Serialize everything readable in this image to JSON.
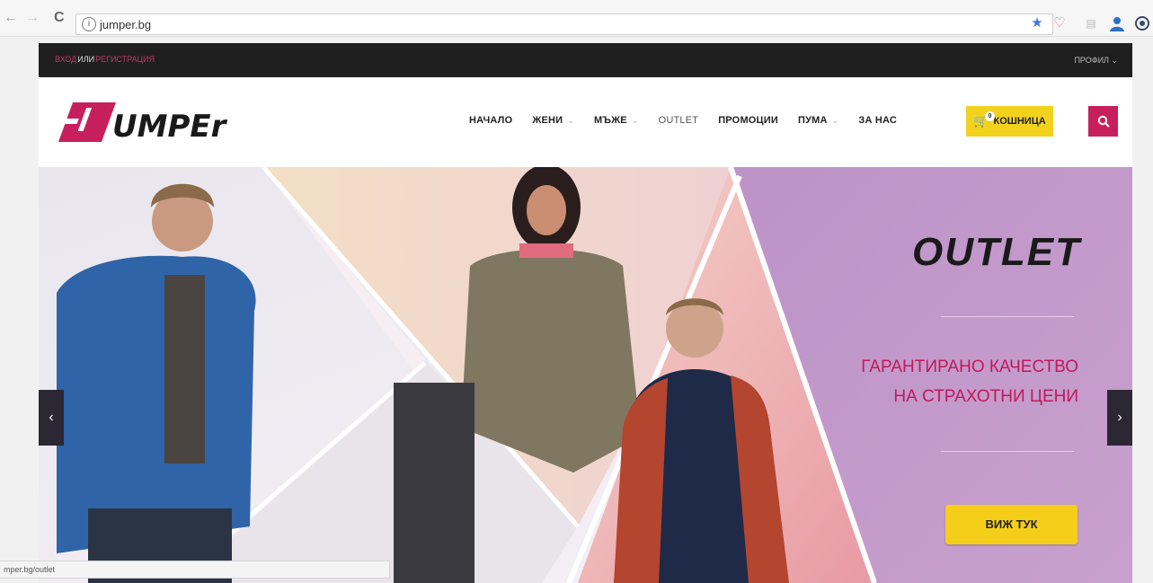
{
  "browser": {
    "back": "←",
    "forward": "→",
    "reload": "C",
    "url": "jumper.bg",
    "status_url": "mper.bg/outlet"
  },
  "site": {
    "topbar": {
      "login": "ВХОД",
      "or": "ИЛИ",
      "register": "РЕГИСТРАЦИЯ",
      "profile": "ПРОФИЛ ⌄"
    },
    "logo": {
      "text": "UMPEr"
    },
    "nav": [
      {
        "label": "НАЧАЛО"
      },
      {
        "label": "ЖЕНИ",
        "dropdown": "⌄"
      },
      {
        "label": "МЪЖЕ",
        "dropdown": "⌄"
      },
      {
        "label": "OUTLET"
      },
      {
        "label": "ПРОМОЦИИ"
      },
      {
        "label": "ПУМА",
        "dropdown": "⌄"
      },
      {
        "label": "ЗА НАС"
      }
    ],
    "cart": {
      "label": "КОШНИЦА",
      "count": "0"
    },
    "hero": {
      "title": "OUTLET",
      "line1": "ГАРАНТИРАНО КАЧЕСТВО",
      "line2": "НА СТРАХОТНИ ЦЕНИ",
      "cta": "ВИЖ ТУК",
      "prev": "‹",
      "next": "›"
    }
  },
  "colors": {
    "brand": "#c71f5c",
    "accent": "#f2d21c",
    "dark": "#1f1f1f",
    "panel": "#b27fbf"
  },
  "icons": [
    "info-icon",
    "star-icon",
    "heart-icon",
    "extension-icon",
    "user-icon",
    "menu-icon",
    "search-icon",
    "cart-icon"
  ]
}
